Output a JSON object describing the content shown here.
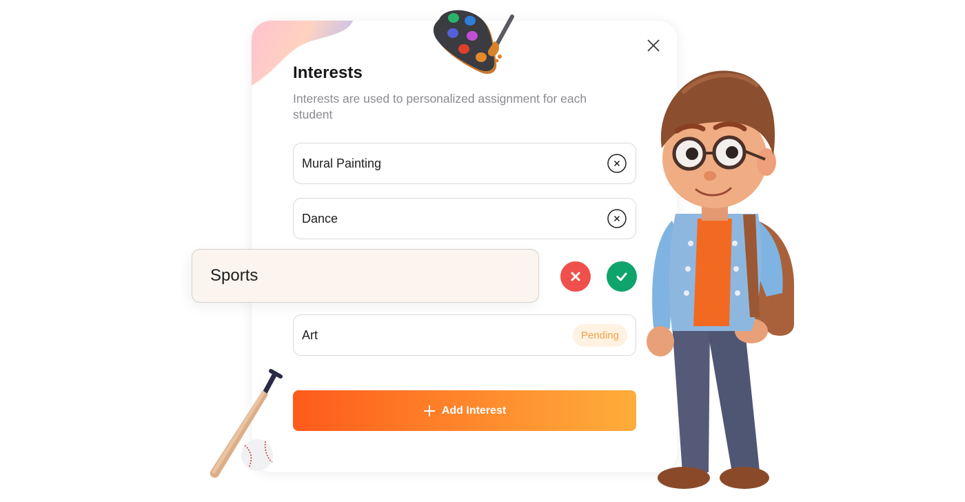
{
  "dialog": {
    "title": "Interests",
    "subtitle": "Interests are used to personalized assignment for each student",
    "close_icon": "close-icon"
  },
  "interests": [
    {
      "label": "Mural Painting",
      "action_icon": "remove-circle-icon"
    },
    {
      "label": "Dance",
      "action_icon": "remove-circle-icon"
    },
    {
      "label": "Art",
      "status": "Pending"
    }
  ],
  "editing": {
    "value": "Sports",
    "cancel_icon": "x-icon",
    "confirm_icon": "check-icon"
  },
  "add_button": {
    "label": "Add Interest",
    "icon": "plus-icon"
  },
  "colors": {
    "accent_start": "#fe5a1b",
    "accent_end": "#ffad3a",
    "cancel": "#f0504c",
    "confirm": "#0ea46b",
    "pending_text": "#f0a24a",
    "pending_bg": "#fff2e2",
    "editing_bg": "#fcf4ee"
  },
  "illustrations": [
    "paint-palette",
    "baseball-bat-and-ball",
    "student-character"
  ]
}
